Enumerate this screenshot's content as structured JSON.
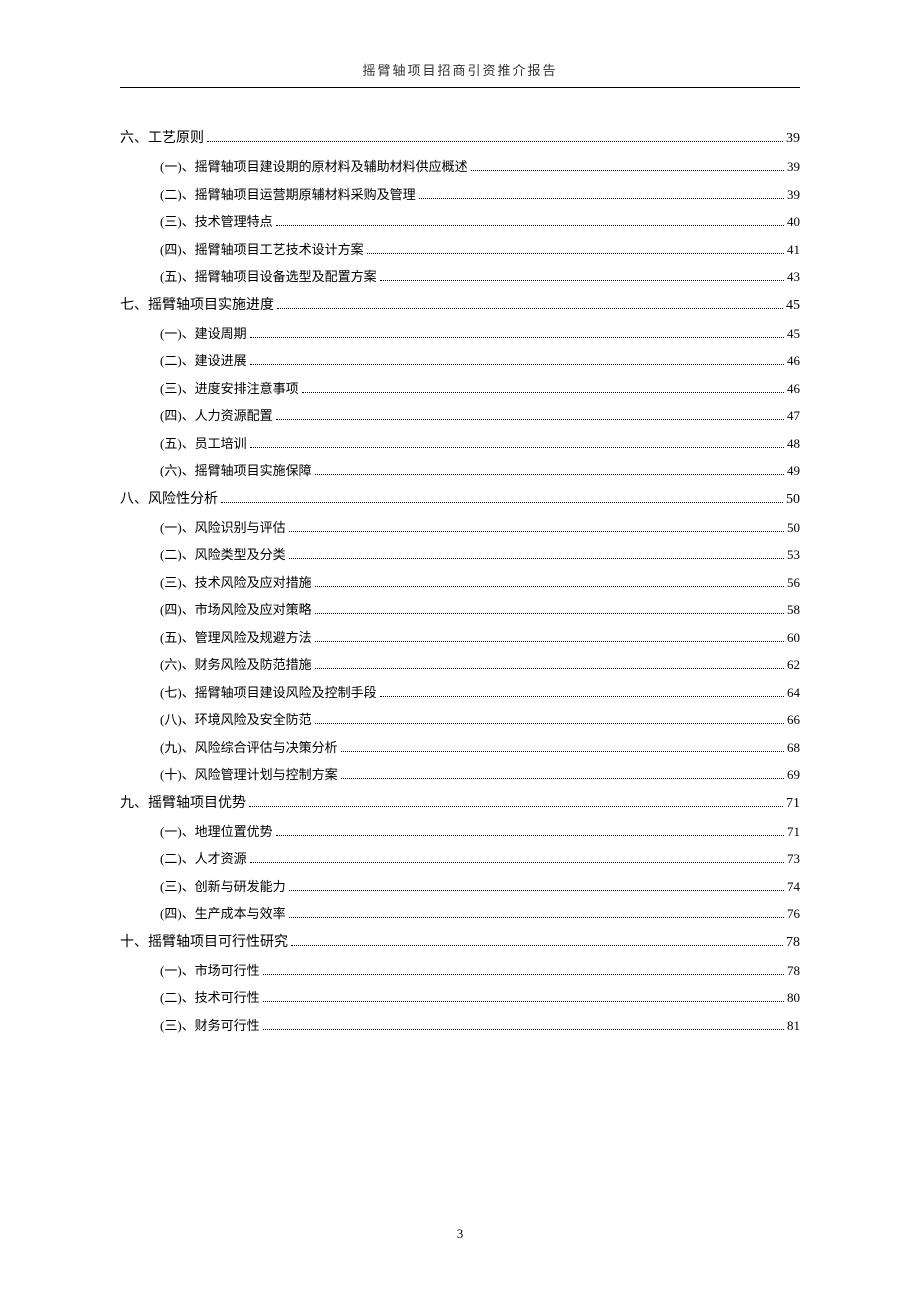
{
  "header": "摇臂轴项目招商引资推介报告",
  "pageNumber": "3",
  "toc": [
    {
      "level": 1,
      "label": "六、工艺原则",
      "page": "39"
    },
    {
      "level": 2,
      "label": "(一)、摇臂轴项目建设期的原材料及辅助材料供应概述",
      "page": "39"
    },
    {
      "level": 2,
      "label": "(二)、摇臂轴项目运营期原辅材料采购及管理",
      "page": "39"
    },
    {
      "level": 2,
      "label": "(三)、技术管理特点",
      "page": "40"
    },
    {
      "level": 2,
      "label": "(四)、摇臂轴项目工艺技术设计方案",
      "page": "41"
    },
    {
      "level": 2,
      "label": "(五)、摇臂轴项目设备选型及配置方案",
      "page": "43"
    },
    {
      "level": 1,
      "label": "七、摇臂轴项目实施进度",
      "page": "45"
    },
    {
      "level": 2,
      "label": "(一)、建设周期",
      "page": "45"
    },
    {
      "level": 2,
      "label": "(二)、建设进展",
      "page": "46"
    },
    {
      "level": 2,
      "label": "(三)、进度安排注意事项",
      "page": "46"
    },
    {
      "level": 2,
      "label": "(四)、人力资源配置",
      "page": "47"
    },
    {
      "level": 2,
      "label": "(五)、员工培训",
      "page": "48"
    },
    {
      "level": 2,
      "label": "(六)、摇臂轴项目实施保障",
      "page": "49"
    },
    {
      "level": 1,
      "label": "八、风险性分析",
      "page": "50"
    },
    {
      "level": 2,
      "label": "(一)、风险识别与评估",
      "page": "50"
    },
    {
      "level": 2,
      "label": "(二)、风险类型及分类",
      "page": "53"
    },
    {
      "level": 2,
      "label": "(三)、技术风险及应对措施",
      "page": "56"
    },
    {
      "level": 2,
      "label": "(四)、市场风险及应对策略",
      "page": "58"
    },
    {
      "level": 2,
      "label": "(五)、管理风险及规避方法",
      "page": "60"
    },
    {
      "level": 2,
      "label": "(六)、财务风险及防范措施",
      "page": "62"
    },
    {
      "level": 2,
      "label": "(七)、摇臂轴项目建设风险及控制手段",
      "page": "64"
    },
    {
      "level": 2,
      "label": "(八)、环境风险及安全防范",
      "page": "66"
    },
    {
      "level": 2,
      "label": "(九)、风险综合评估与决策分析",
      "page": "68"
    },
    {
      "level": 2,
      "label": "(十)、风险管理计划与控制方案",
      "page": "69"
    },
    {
      "level": 1,
      "label": "九、摇臂轴项目优势",
      "page": "71"
    },
    {
      "level": 2,
      "label": "(一)、地理位置优势",
      "page": "71"
    },
    {
      "level": 2,
      "label": "(二)、人才资源",
      "page": "73"
    },
    {
      "level": 2,
      "label": "(三)、创新与研发能力",
      "page": "74"
    },
    {
      "level": 2,
      "label": "(四)、生产成本与效率",
      "page": "76"
    },
    {
      "level": 1,
      "label": "十、摇臂轴项目可行性研究",
      "page": "78"
    },
    {
      "level": 2,
      "label": "(一)、市场可行性",
      "page": "78"
    },
    {
      "level": 2,
      "label": "(二)、技术可行性",
      "page": "80"
    },
    {
      "level": 2,
      "label": "(三)、财务可行性",
      "page": "81"
    }
  ]
}
